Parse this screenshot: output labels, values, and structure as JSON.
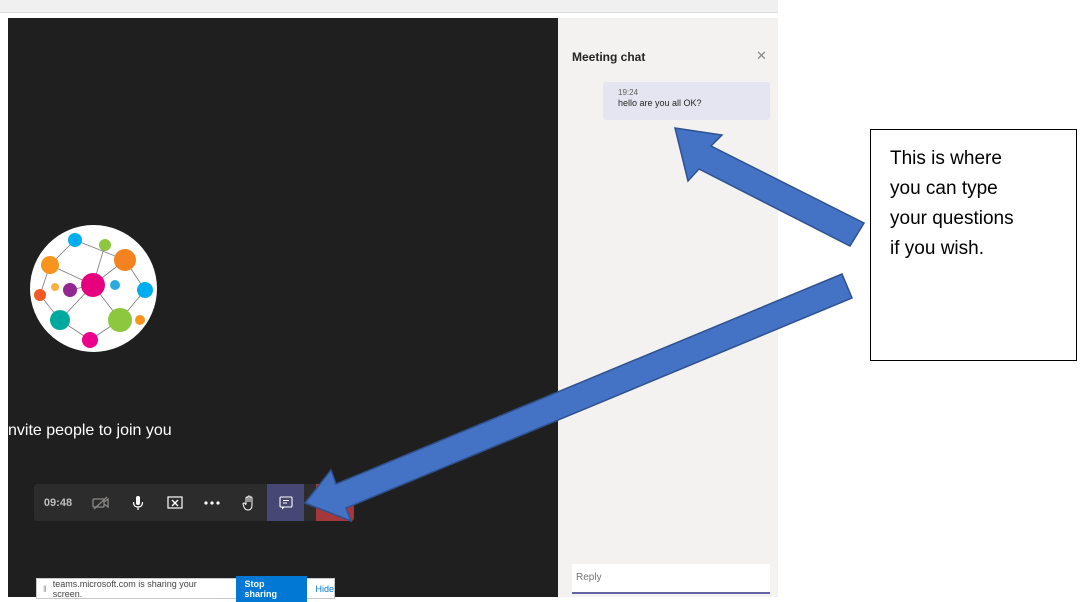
{
  "meeting": {
    "invite_text": "nvite people to join you"
  },
  "toolbar": {
    "timer": "09:48",
    "icons": [
      "camera-off-icon",
      "microphone-icon",
      "share-screen-icon",
      "more-icon",
      "raise-hand-icon",
      "chat-icon",
      "hang-up-icon"
    ]
  },
  "share_bar": {
    "message": "teams.microsoft.com is sharing your screen.",
    "stop_label": "Stop sharing",
    "hide_label": "Hide"
  },
  "chat": {
    "title": "Meeting chat",
    "messages": [
      {
        "time": "19:24",
        "text": "hello are you all OK?"
      }
    ],
    "reply_placeholder": "Reply"
  },
  "callout": {
    "lines": [
      "This is where",
      "you can type",
      "your questions",
      "if you wish."
    ]
  },
  "colors": {
    "stage_bg": "#201f1f",
    "chat_bg": "#f3f2f1",
    "message_bg": "#e5e5f1",
    "accent": "#6264a7",
    "end_call": "#a4373a",
    "arrow_fill": "#4472c4",
    "arrow_stroke": "#2f528f"
  }
}
